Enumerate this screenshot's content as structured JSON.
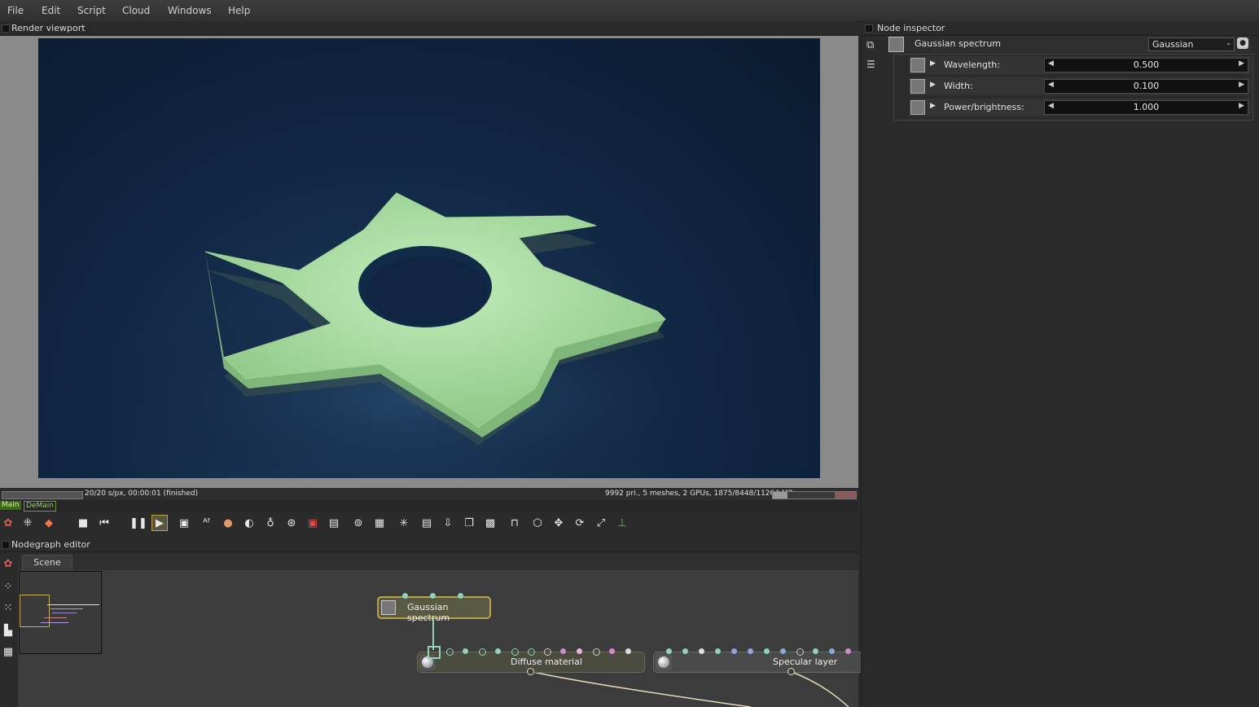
{
  "menu": [
    "File",
    "Edit",
    "Script",
    "Cloud",
    "Windows",
    "Help"
  ],
  "viewport": {
    "title": "Render viewport",
    "status_left": "20/20 s/px, 00:00:01 (finished)",
    "status_right": "9992 pri., 5 meshes, 2 GPUs, 1875/8448/11264 MB"
  },
  "render_targets": [
    "Main",
    "DeMain"
  ],
  "nodegraph": {
    "title": "Nodegraph editor",
    "tab": "Scene",
    "nodes": {
      "gaussian": "Gaussian spectrum",
      "diffuse": "Diffuse material",
      "specular": "Specular layer"
    }
  },
  "inspector": {
    "title": "Node inspector",
    "node_name": "Gaussian spectrum",
    "dropdown_value": "Gaussian",
    "params": [
      {
        "label": "Wavelength:",
        "value": "0.500"
      },
      {
        "label": "Width:",
        "value": "0.100"
      },
      {
        "label": "Power/brightness:",
        "value": "1.000"
      }
    ]
  },
  "colors": {
    "accent": "#b7a24a",
    "object": "#a8dca0",
    "main_tab": "#5a8f23"
  },
  "icons": [
    "stop-icon",
    "rewind-icon",
    "pause-icon",
    "play-icon",
    "eye-icon",
    "move-icon",
    "rotate-icon",
    "fit-icon",
    "axis-icon"
  ]
}
